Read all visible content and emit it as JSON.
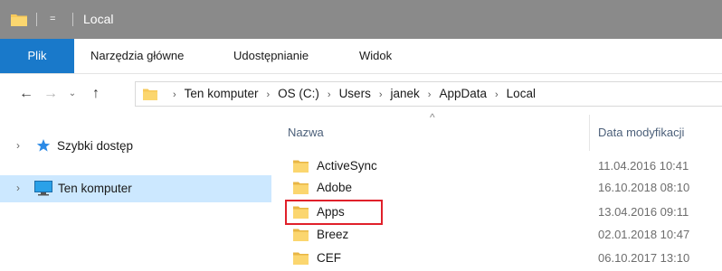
{
  "window": {
    "title": "Local",
    "icon": "folder-icon",
    "quick_access_arrow": "="
  },
  "ribbon": {
    "tabs": [
      {
        "label": "Plik"
      },
      {
        "label": "Narzędzia główne"
      },
      {
        "label": "Udostępnianie"
      },
      {
        "label": "Widok"
      }
    ]
  },
  "address": {
    "back": "←",
    "forward": "→",
    "recent": "⌄",
    "up": "↑",
    "separator": "›",
    "crumbs": [
      "Ten komputer",
      "OS (C:)",
      "Users",
      "janek",
      "AppData",
      "Local"
    ]
  },
  "nav_pane": {
    "items": [
      {
        "label": "Szybki dostęp",
        "icon": "star-icon",
        "expand": "›"
      },
      {
        "label": "Ten komputer",
        "icon": "computer-icon",
        "expand": "›"
      }
    ]
  },
  "file_list": {
    "columns": {
      "name": "Nazwa",
      "date": "Data modyfikacji",
      "sort_indicator": "^"
    },
    "rows": [
      {
        "name": "ActiveSync",
        "date": "11.04.2016 10:41"
      },
      {
        "name": "Adobe",
        "date": "16.10.2018 08:10"
      },
      {
        "name": "Apps",
        "date": "13.04.2016 09:11"
      },
      {
        "name": "Breez",
        "date": "02.01.2018 10:47"
      },
      {
        "name": "CEF",
        "date": "06.10.2017 13:10"
      }
    ]
  },
  "colors": {
    "titlebar": "#8a8a8a",
    "file_tab": "#1979ca",
    "nav_selected": "#cce8ff",
    "folder": "#f7c95a",
    "highlight": "#e0202a"
  }
}
